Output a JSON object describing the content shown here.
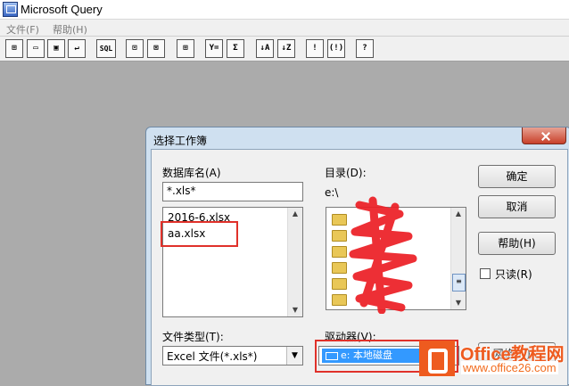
{
  "window": {
    "title": "Microsoft Query"
  },
  "menu": [
    {
      "label": "文件(F)"
    },
    {
      "label": "帮助(H)"
    }
  ],
  "toolbar": {
    "sql_label": "SQL",
    "sum_label": "Σ",
    "bang_label": "!",
    "help_label": "?"
  },
  "dialog": {
    "title": "选择工作簿",
    "db_label": "数据库名(A)",
    "db_value": "*.xls*",
    "files": [
      "2016-6.xlsx",
      "aa.xlsx"
    ],
    "dir_label": "目录(D):",
    "dir_value": "e:\\",
    "ok_label": "确定",
    "cancel_label": "取消",
    "help_label": "帮助(H)",
    "readonly_label": "只读(R)",
    "filetype_label": "文件类型(T):",
    "filetype_value": "Excel 文件(*.xls*)",
    "drive_label": "驱动器(V):",
    "drive_value": "e: 本地磁盘",
    "net_label": "网络(N)..."
  },
  "watermark": {
    "brand": "Office教程网",
    "url": "www.office26.com"
  },
  "colors": {
    "highlight": "#3399ff",
    "annotation_red": "#e0312a",
    "watermark": "#ee5b1f"
  }
}
